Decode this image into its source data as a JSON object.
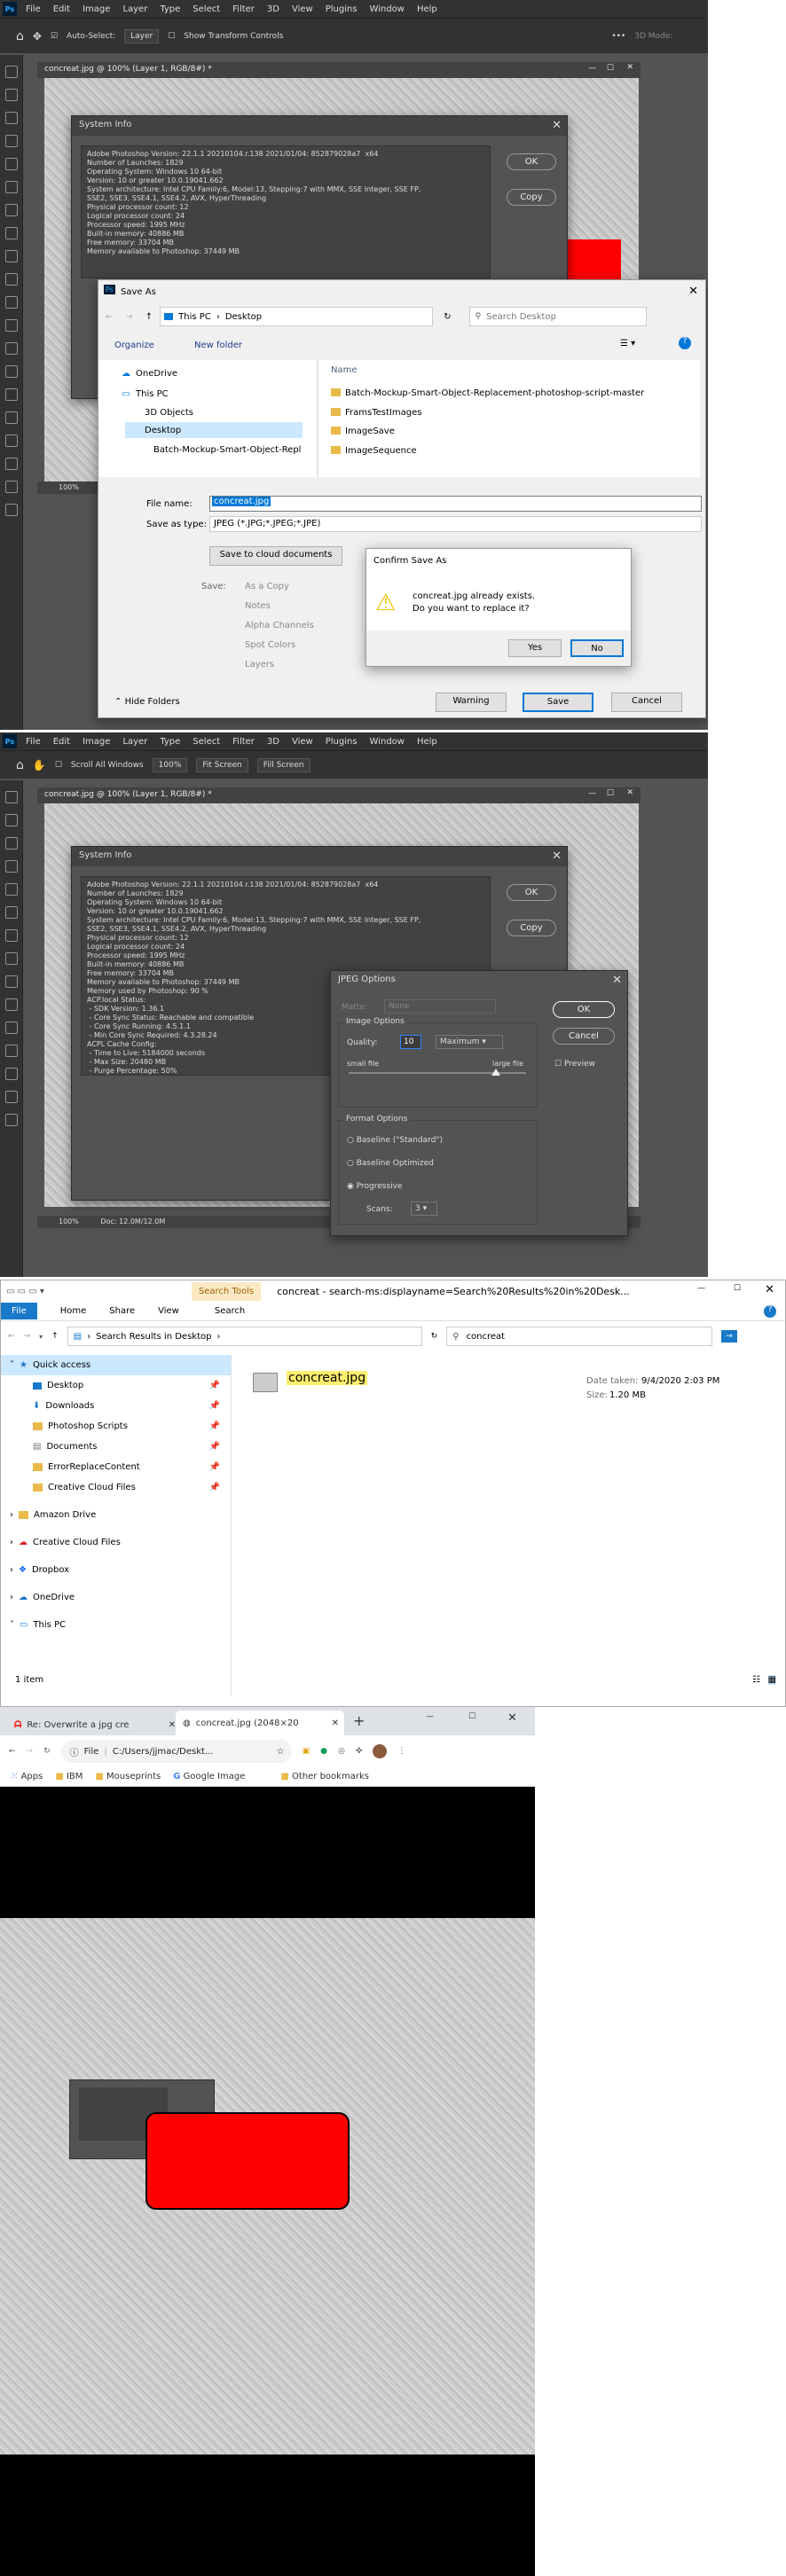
{
  "ps_menu": [
    "File",
    "Edit",
    "Image",
    "Layer",
    "Type",
    "Select",
    "Filter",
    "3D",
    "View",
    "Plugins",
    "Window",
    "Help"
  ],
  "ps_app_short": "Ps",
  "ps1": {
    "opt_auto_select": "Auto-Select:",
    "opt_layer": "Layer",
    "opt_show_transform": "Show Transform Controls",
    "opt_3d_mode": "3D Mode:",
    "doc_tab": "concreat.jpg @ 100% (Layer 1, RGB/8#) *",
    "zoom": "100%"
  },
  "ps2": {
    "opt_scroll_all": "Scroll All Windows",
    "opt_100": "100%",
    "opt_fit": "Fit Screen",
    "opt_fill": "Fill Screen",
    "doc_tab": "concreat.jpg @ 100% (Layer 1, RGB/8#) *",
    "zoom": "100%",
    "doc_size": "Doc: 12.0M/12.0M"
  },
  "sysinfo": {
    "title": "System Info",
    "ok": "OK",
    "copy": "Copy",
    "text1": "Adobe Photoshop Version: 22.1.1 20210104.r.138 2021/01/04: 852879028a7  x64\nNumber of Launches: 1829\nOperating System: Windows 10 64-bit\nVersion: 10 or greater 10.0.19041.662\nSystem architecture: Intel CPU Family:6, Model:13, Stepping:7 with MMX, SSE Integer, SSE FP,\nSSE2, SSE3, SSE4.1, SSE4.2, AVX, HyperThreading\nPhysical processor count: 12\nLogical processor count: 24\nProcessor speed: 1995 MHz\nBuilt-in memory: 40886 MB\nFree memory: 33704 MB\nMemory available to Photoshop: 37449 MB",
    "text2": "Adobe Photoshop Version: 22.1.1 20210104.r.138 2021/01/04: 852879028a7  x64\nNumber of Launches: 1829\nOperating System: Windows 10 64-bit\nVersion: 10 or greater 10.0.19041.662\nSystem architecture: Intel CPU Family:6, Model:13, Stepping:7 with MMX, SSE Integer, SSE FP,\nSSE2, SSE3, SSE4.1, SSE4.2, AVX, HyperThreading\nPhysical processor count: 12\nLogical processor count: 24\nProcessor speed: 1995 MHz\nBuilt-in memory: 40886 MB\nFree memory: 33704 MB\nMemory available to Photoshop: 37449 MB\nMemory used by Photoshop: 90 %\nACP.local Status:\n - SDK Version: 1.36.1\n - Core Sync Status: Reachable and compatible\n - Core Sync Running: 4.5.1.1\n - Min Core Sync Required: 4.3.28.24\nACPL Cache Config:\n - Time to Live: 5184000 seconds\n - Max Size: 20480 MB\n - Purge Percentage: 50%"
  },
  "saveas": {
    "title": "Save As",
    "crumb_pc": "This PC",
    "crumb_desktop": "Desktop",
    "search_placeholder": "Search Desktop",
    "organize": "Organize",
    "new_folder": "New folder",
    "tree": [
      "OneDrive",
      "This PC",
      "3D Objects",
      "Desktop",
      "Batch-Mockup-Smart-Object-Repl"
    ],
    "col_name": "Name",
    "files": [
      "Batch-Mockup-Smart-Object-Replacement-photoshop-script-master",
      "FramsTestImages",
      "ImageSave",
      "ImageSequence"
    ],
    "file_name_label": "File name:",
    "file_name_value": "concreat.jpg",
    "type_label": "Save as type:",
    "type_value": "JPEG (*.JPG;*.JPEG;*.JPE)",
    "cloud_button": "Save to cloud documents",
    "save_label": "Save:",
    "options": [
      "As a Copy",
      "Notes",
      "Alpha Channels",
      "Spot Colors",
      "Layers"
    ],
    "hide_folders": "Hide Folders",
    "warning": "Warning",
    "save": "Save",
    "cancel": "Cancel"
  },
  "confirm": {
    "title": "Confirm Save As",
    "line1": "concreat.jpg already exists.",
    "line2": "Do you want to replace it?",
    "yes": "Yes",
    "no": "No"
  },
  "jpeg": {
    "title": "JPEG Options",
    "matte_label": "Matte:",
    "matte_value": "None",
    "image_options": "Image Options",
    "quality_label": "Quality:",
    "quality_value": "10",
    "quality_preset": "Maximum",
    "quality_fraction": 0.83,
    "small_file": "small file",
    "large_file": "large file",
    "format_options": "Format Options",
    "formats": [
      "Baseline (\"Standard\")",
      "Baseline Optimized",
      "Progressive"
    ],
    "scans_label": "Scans:",
    "scans_value": "3",
    "ok": "OK",
    "cancel": "Cancel",
    "preview": "Preview"
  },
  "explorer": {
    "title": "concreat - search-ms:displayname=Search%20Results%20in%20Desk...",
    "search_tools": "Search Tools",
    "ribbon_tabs": [
      "File",
      "Home",
      "Share",
      "View",
      "Search"
    ],
    "address": "Search Results in Desktop",
    "search_value": "concreat",
    "nav": [
      "Quick access",
      "Desktop",
      "Downloads",
      "Photoshop Scripts",
      "Documents",
      "ErrorReplaceContent",
      "Creative Cloud Files",
      "Amazon Drive",
      "Creative Cloud Files",
      "Dropbox",
      "OneDrive",
      "This PC"
    ],
    "file_name": "concreat.jpg",
    "date_label": "Date taken:",
    "date_value": "9/4/2020 2:03 PM",
    "size_label": "Size:",
    "size_value": "1.20 MB",
    "status": "1 item"
  },
  "chrome": {
    "tab1": "Re: Overwrite a jpg cre",
    "tab2": "concreat.jpg (2048×20",
    "url_label": "File",
    "url": "C:/Users/jjmac/Deskt...",
    "bookmarks": [
      "Apps",
      "IBM",
      "Mouseprints",
      "Google Image",
      "Other bookmarks"
    ]
  }
}
